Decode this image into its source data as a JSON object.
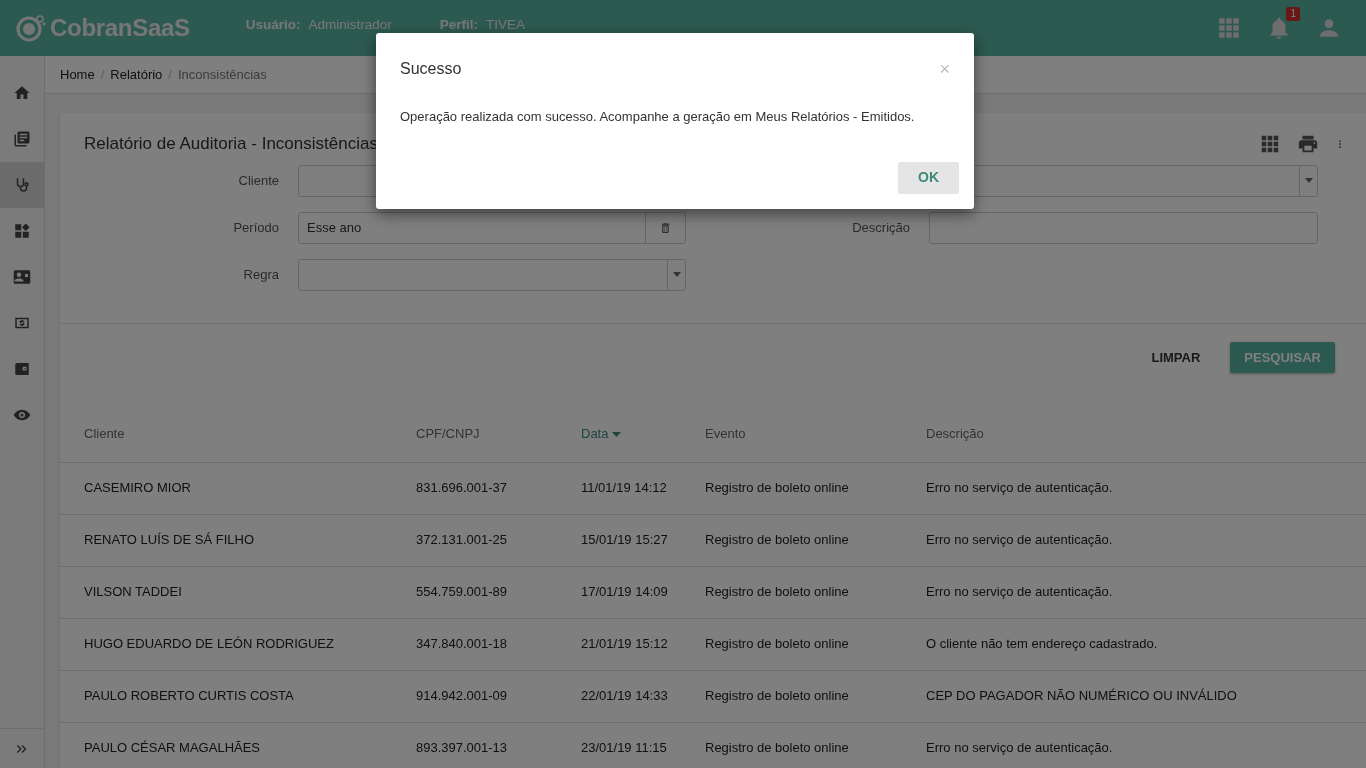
{
  "header": {
    "logo": "CobranSaaS",
    "user_label": "Usuário:",
    "user_value": "Administrador",
    "profile_label": "Perfil:",
    "profile_value": "TIVEA",
    "notification_count": "1"
  },
  "sidebar": {
    "items": [
      {
        "selected": false
      },
      {
        "selected": false
      },
      {
        "selected": true
      },
      {
        "selected": false
      },
      {
        "selected": false
      },
      {
        "selected": false
      },
      {
        "selected": false
      },
      {
        "selected": false
      }
    ]
  },
  "breadcrumb": [
    {
      "label": "Home",
      "active": false
    },
    {
      "separator": "/"
    },
    {
      "label": "Relatório",
      "active": false
    },
    {
      "separator": "/"
    },
    {
      "label": "Inconsistências",
      "active": true
    }
  ],
  "card": {
    "title": "Relatório de Auditoria - Inconsistências",
    "filters": [
      {
        "label": "Cliente",
        "kind": "select",
        "wide": true
      },
      {
        "label": "Período",
        "kind": "clearable",
        "value": "Esse ano"
      },
      {
        "label": "Descrição",
        "kind": "text"
      },
      {
        "label": "Regra",
        "kind": "select"
      }
    ],
    "buttons": [
      {
        "label": "LIMPAR",
        "kind": "flat"
      },
      {
        "label": "PESQUISAR",
        "kind": "raised"
      }
    ]
  },
  "table": {
    "columns": [
      {
        "label": "Cliente",
        "sorted": false
      },
      {
        "label": "CPF/CNPJ",
        "sorted": false
      },
      {
        "label": "Data",
        "sorted": true
      },
      {
        "label": "Evento",
        "sorted": false
      },
      {
        "label": "Descrição",
        "sorted": false
      }
    ],
    "rows": [
      [
        "CASEMIRO MIOR",
        "831.696.001-37",
        "11/01/19 14:12",
        "Registro de boleto online",
        "Erro no serviço de autenticação."
      ],
      [
        "RENATO LUÍS DE SÁ FILHO",
        "372.131.001-25",
        "15/01/19 15:27",
        "Registro de boleto online",
        "Erro no serviço de autenticação."
      ],
      [
        "VILSON TADDEI",
        "554.759.001-89",
        "17/01/19 14:09",
        "Registro de boleto online",
        "Erro no serviço de autenticação."
      ],
      [
        "HUGO EDUARDO DE LEÓN RODRIGUEZ",
        "347.840.001-18",
        "21/01/19 15:12",
        "Registro de boleto online",
        "O cliente não tem endereço cadastrado."
      ],
      [
        "PAULO ROBERTO CURTIS COSTA",
        "914.942.001-09",
        "22/01/19 14:33",
        "Registro de boleto online",
        "CEP DO PAGADOR NÃO NUMÉRICO OU INVÁLIDO"
      ],
      [
        "PAULO CÉSAR MAGALHÃES",
        "893.397.001-13",
        "23/01/19 11:15",
        "Registro de boleto online",
        "Erro no serviço de autenticação."
      ]
    ]
  },
  "modal": {
    "title": "Sucesso",
    "close": "×",
    "message": "Operação realizada com sucesso. Acompanhe a geração em Meus Relatórios - Emitidos.",
    "button": "OK"
  }
}
